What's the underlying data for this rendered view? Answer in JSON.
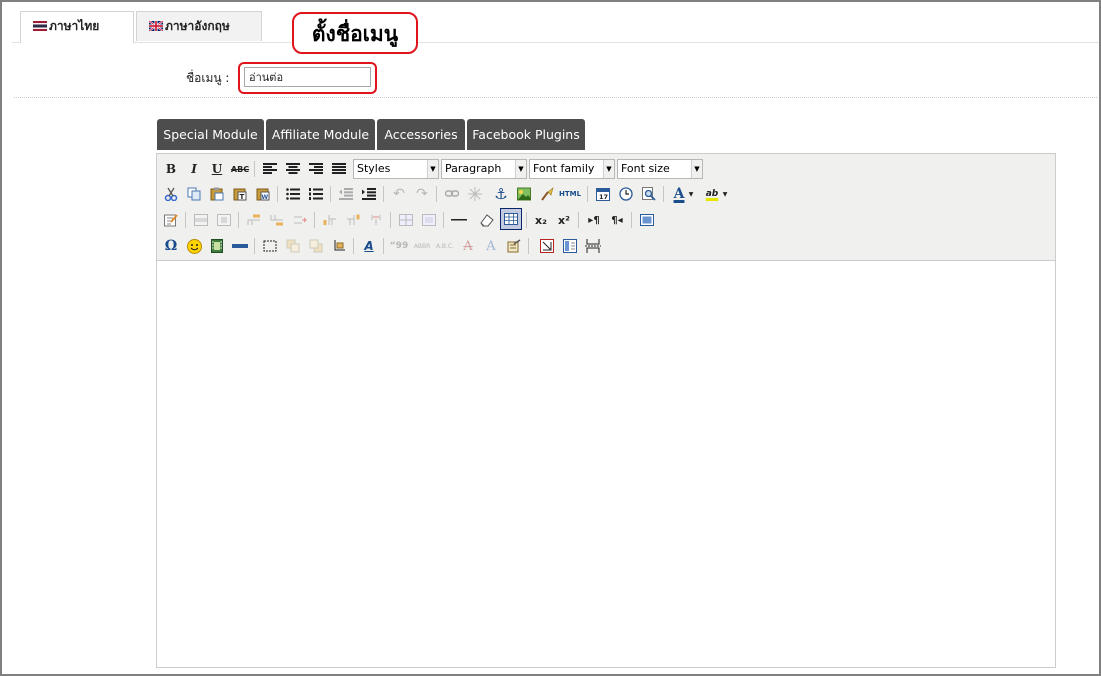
{
  "tabs": [
    {
      "label": "ภาษาไทย",
      "flag": "thai-flag-icon",
      "active": true
    },
    {
      "label": "ภาษาอังกฤษ",
      "flag": "uk-flag-icon",
      "active": false
    }
  ],
  "callout": {
    "text": "ตั้งชื่อเมนู",
    "color": "#e0141c"
  },
  "form": {
    "menu_name_label": "ชื่อเมนู :",
    "menu_name_value": "อ่านต่อ"
  },
  "modules": {
    "special": "Special Module",
    "affiliate": "Affiliate Module",
    "accessories": "Accessories",
    "facebook": "Facebook Plugins"
  },
  "toolbar": {
    "styles": "Styles",
    "format": "Paragraph",
    "font_family": "Font family",
    "font_size": "Font size",
    "bold": "B",
    "italic": "I",
    "underline": "U",
    "strike": "ABC",
    "html": "HTML",
    "special_char": "Ω",
    "font_color": "A",
    "highlight": "ab",
    "subscript": "x₂",
    "superscript": "x²"
  },
  "colors": {
    "button_bg": "#4d4d4d",
    "toolbar_bg": "#f0f0ee",
    "accent": "#e0141c"
  }
}
